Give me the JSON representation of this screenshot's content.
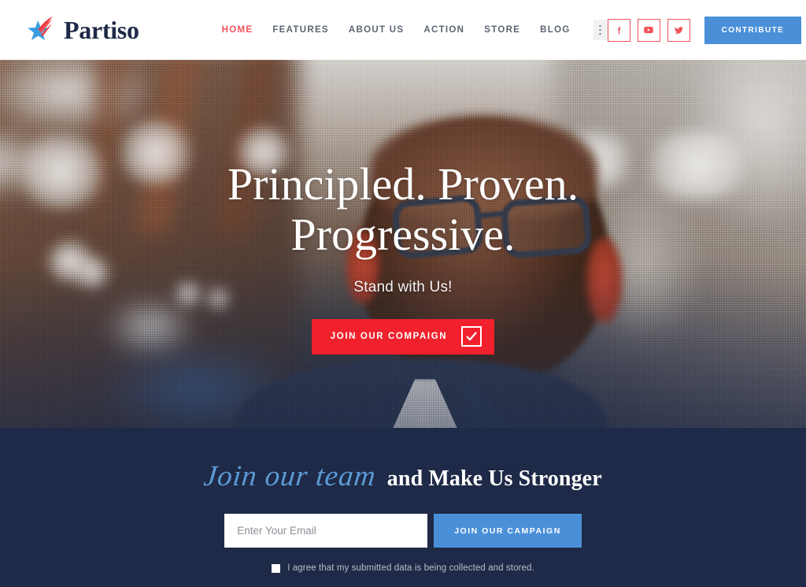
{
  "brand": {
    "name": "Partiso",
    "logo_icon": "star-swoosh-logo"
  },
  "nav": {
    "items": [
      {
        "label": "HOME",
        "active": true
      },
      {
        "label": "FEATURES",
        "active": false
      },
      {
        "label": "ABOUT US",
        "active": false
      },
      {
        "label": "ACTION",
        "active": false
      },
      {
        "label": "STORE",
        "active": false
      },
      {
        "label": "BLOG",
        "active": false
      }
    ],
    "more_icon": "vertical-dots-icon"
  },
  "header": {
    "social": [
      {
        "name": "facebook-icon",
        "glyph": "f"
      },
      {
        "name": "youtube-icon",
        "glyph": "▶"
      },
      {
        "name": "twitter-icon",
        "glyph": "🐦"
      }
    ],
    "contribute_label": "CONTRIBUTE"
  },
  "hero": {
    "title_line1": "Principled. Proven.",
    "title_line2": "Progressive.",
    "subtitle": "Stand with Us!",
    "cta_label": "JOIN OUR COMPAIGN",
    "cta_icon": "checkbox-check-icon",
    "slides": [
      {
        "active": true
      },
      {
        "active": false
      },
      {
        "active": false
      }
    ]
  },
  "join": {
    "heading_script": "Join our team",
    "heading_bold": "and Make Us Stronger",
    "email_placeholder": "Enter Your Email",
    "email_value": "",
    "submit_label": "JOIN OUR CAMPAIGN",
    "consent_text": "I agree that my submitted data is being collected and stored.",
    "consent_checked": false
  },
  "colors": {
    "navy": "#1e2a47",
    "red": "#f0212c",
    "nav_active_red": "#f4515b",
    "blue": "#4a90d9",
    "script_blue": "#5b9bd5",
    "white": "#ffffff"
  }
}
